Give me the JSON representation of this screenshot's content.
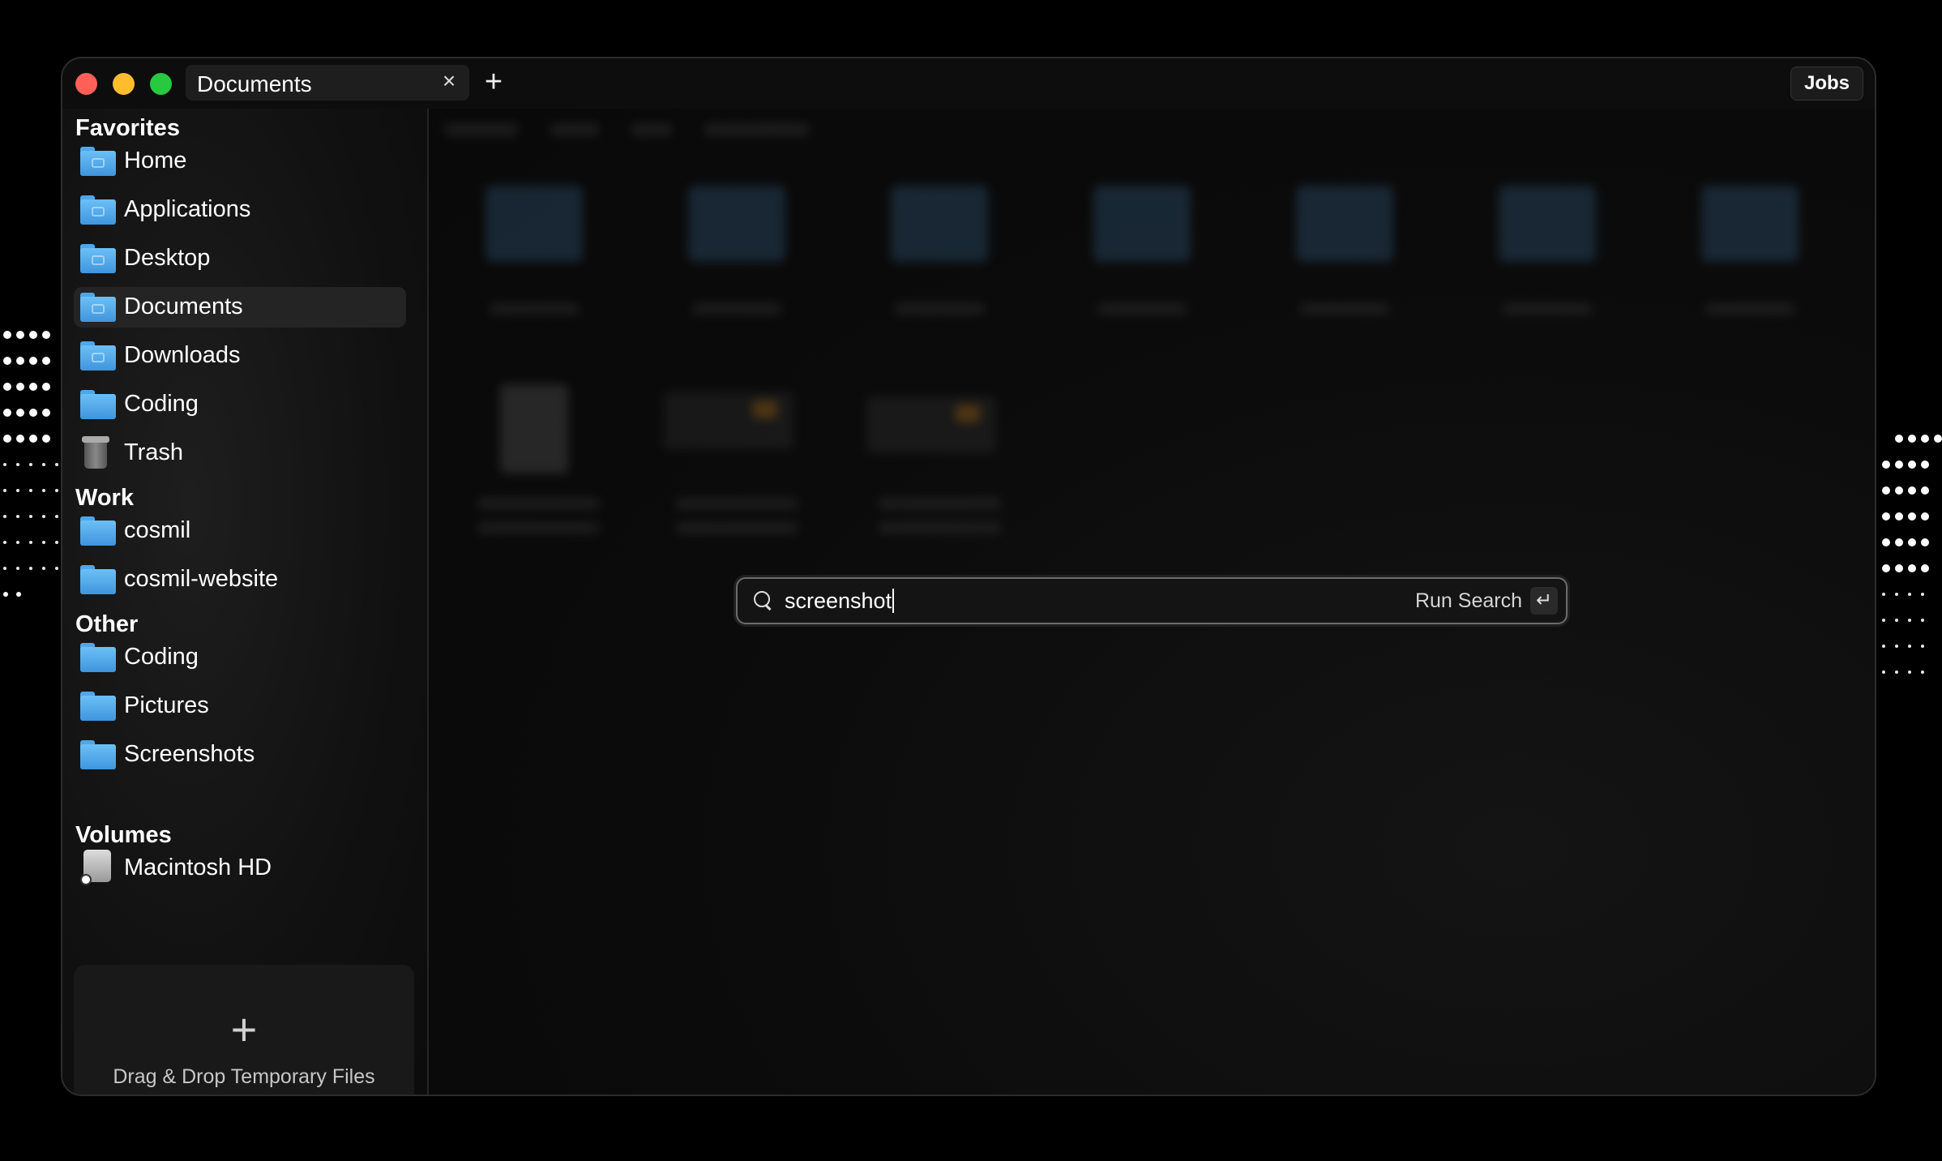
{
  "window": {
    "tab_title": "Documents",
    "tab_close": "×",
    "new_tab": "+",
    "jobs_label": "Jobs",
    "traffic_colors": [
      "#ff5f57",
      "#febc2e",
      "#28c840"
    ]
  },
  "sidebar": {
    "favorites_title": "Favorites",
    "favorites": [
      {
        "label": "Home",
        "icon": "home-folder-icon"
      },
      {
        "label": "Applications",
        "icon": "applications-folder-icon"
      },
      {
        "label": "Desktop",
        "icon": "desktop-folder-icon"
      },
      {
        "label": "Documents",
        "icon": "documents-folder-icon",
        "selected": true
      },
      {
        "label": "Downloads",
        "icon": "downloads-folder-icon"
      },
      {
        "label": "Coding",
        "icon": "folder-icon"
      },
      {
        "label": "Trash",
        "icon": "trash-icon"
      }
    ],
    "work_title": "Work",
    "work": [
      {
        "label": "cosmil",
        "icon": "folder-icon"
      },
      {
        "label": "cosmil-website",
        "icon": "folder-icon"
      }
    ],
    "other_title": "Other",
    "other": [
      {
        "label": "Coding",
        "icon": "folder-icon"
      },
      {
        "label": "Pictures",
        "icon": "folder-icon"
      },
      {
        "label": "Screenshots",
        "icon": "folder-icon"
      }
    ],
    "volumes_title": "Volumes",
    "volumes": [
      {
        "label": "Macintosh HD",
        "icon": "hard-drive-icon"
      }
    ],
    "dropzone_plus": "+",
    "dropzone_label": "Drag & Drop Temporary Files"
  },
  "search": {
    "value": "screenshot",
    "run_label": "Run Search",
    "enter_glyph": "↵"
  }
}
